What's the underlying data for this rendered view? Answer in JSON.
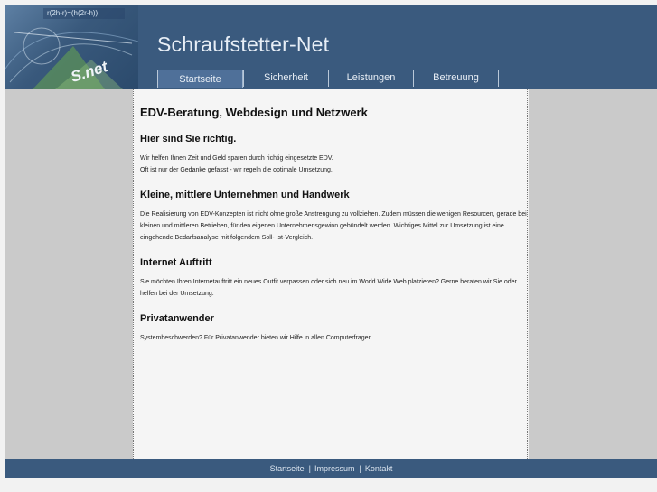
{
  "site": {
    "title": "Schraufstetter-Net",
    "logo_text": "S.net",
    "logo_formula": "r(2h-r)=(h(2r-h))"
  },
  "nav": [
    {
      "label": "Startseite",
      "active": true
    },
    {
      "label": "Sicherheit",
      "active": false
    },
    {
      "label": "Leistungen",
      "active": false
    },
    {
      "label": "Betreuung",
      "active": false
    }
  ],
  "content": {
    "heading": "EDV-Beratung, Webdesign und Netzwerk",
    "sections": [
      {
        "title": "Hier sind Sie richtig.",
        "lines": [
          "Wir helfen Ihnen Zeit und Geld sparen durch richtig eingesetzte EDV.",
          "Oft ist nur der Gedanke gefasst - wir regeln die optimale Umsetzung."
        ]
      },
      {
        "title": "Kleine, mittlere Unternehmen und Handwerk",
        "lines": [
          "Die Realisierung von EDV-Konzepten ist nicht ohne große Anstrengung zu vollziehen. Zudem müssen die wenigen Resourcen, gerade bei kleinen und mittleren Betrieben, für den eigenen Unternehmensgewinn gebündelt werden. Wichtiges Mittel zur Umsetzung ist eine eingehende Bedarfsanalyse mit folgendem Soll- Ist-Vergleich."
        ]
      },
      {
        "title": "Internet Auftritt",
        "lines": [
          "Sie möchten Ihren Internetauftritt ein neues Outfit verpassen oder sich neu im World Wide Web platzieren? Gerne beraten wir Sie oder helfen bei der Umsetzung."
        ]
      },
      {
        "title": "Privatanwender",
        "lines": [
          "Systembeschwerden? Für Privatanwender bieten wir Hilfe in allen Computerfragen."
        ]
      }
    ]
  },
  "footer": {
    "links": [
      "Startseite",
      "Impressum",
      "Kontakt"
    ],
    "separator": "|"
  },
  "colors": {
    "header": "#3a5a7e",
    "sidebar": "#cacaca",
    "content_bg": "#f5f5f5"
  }
}
